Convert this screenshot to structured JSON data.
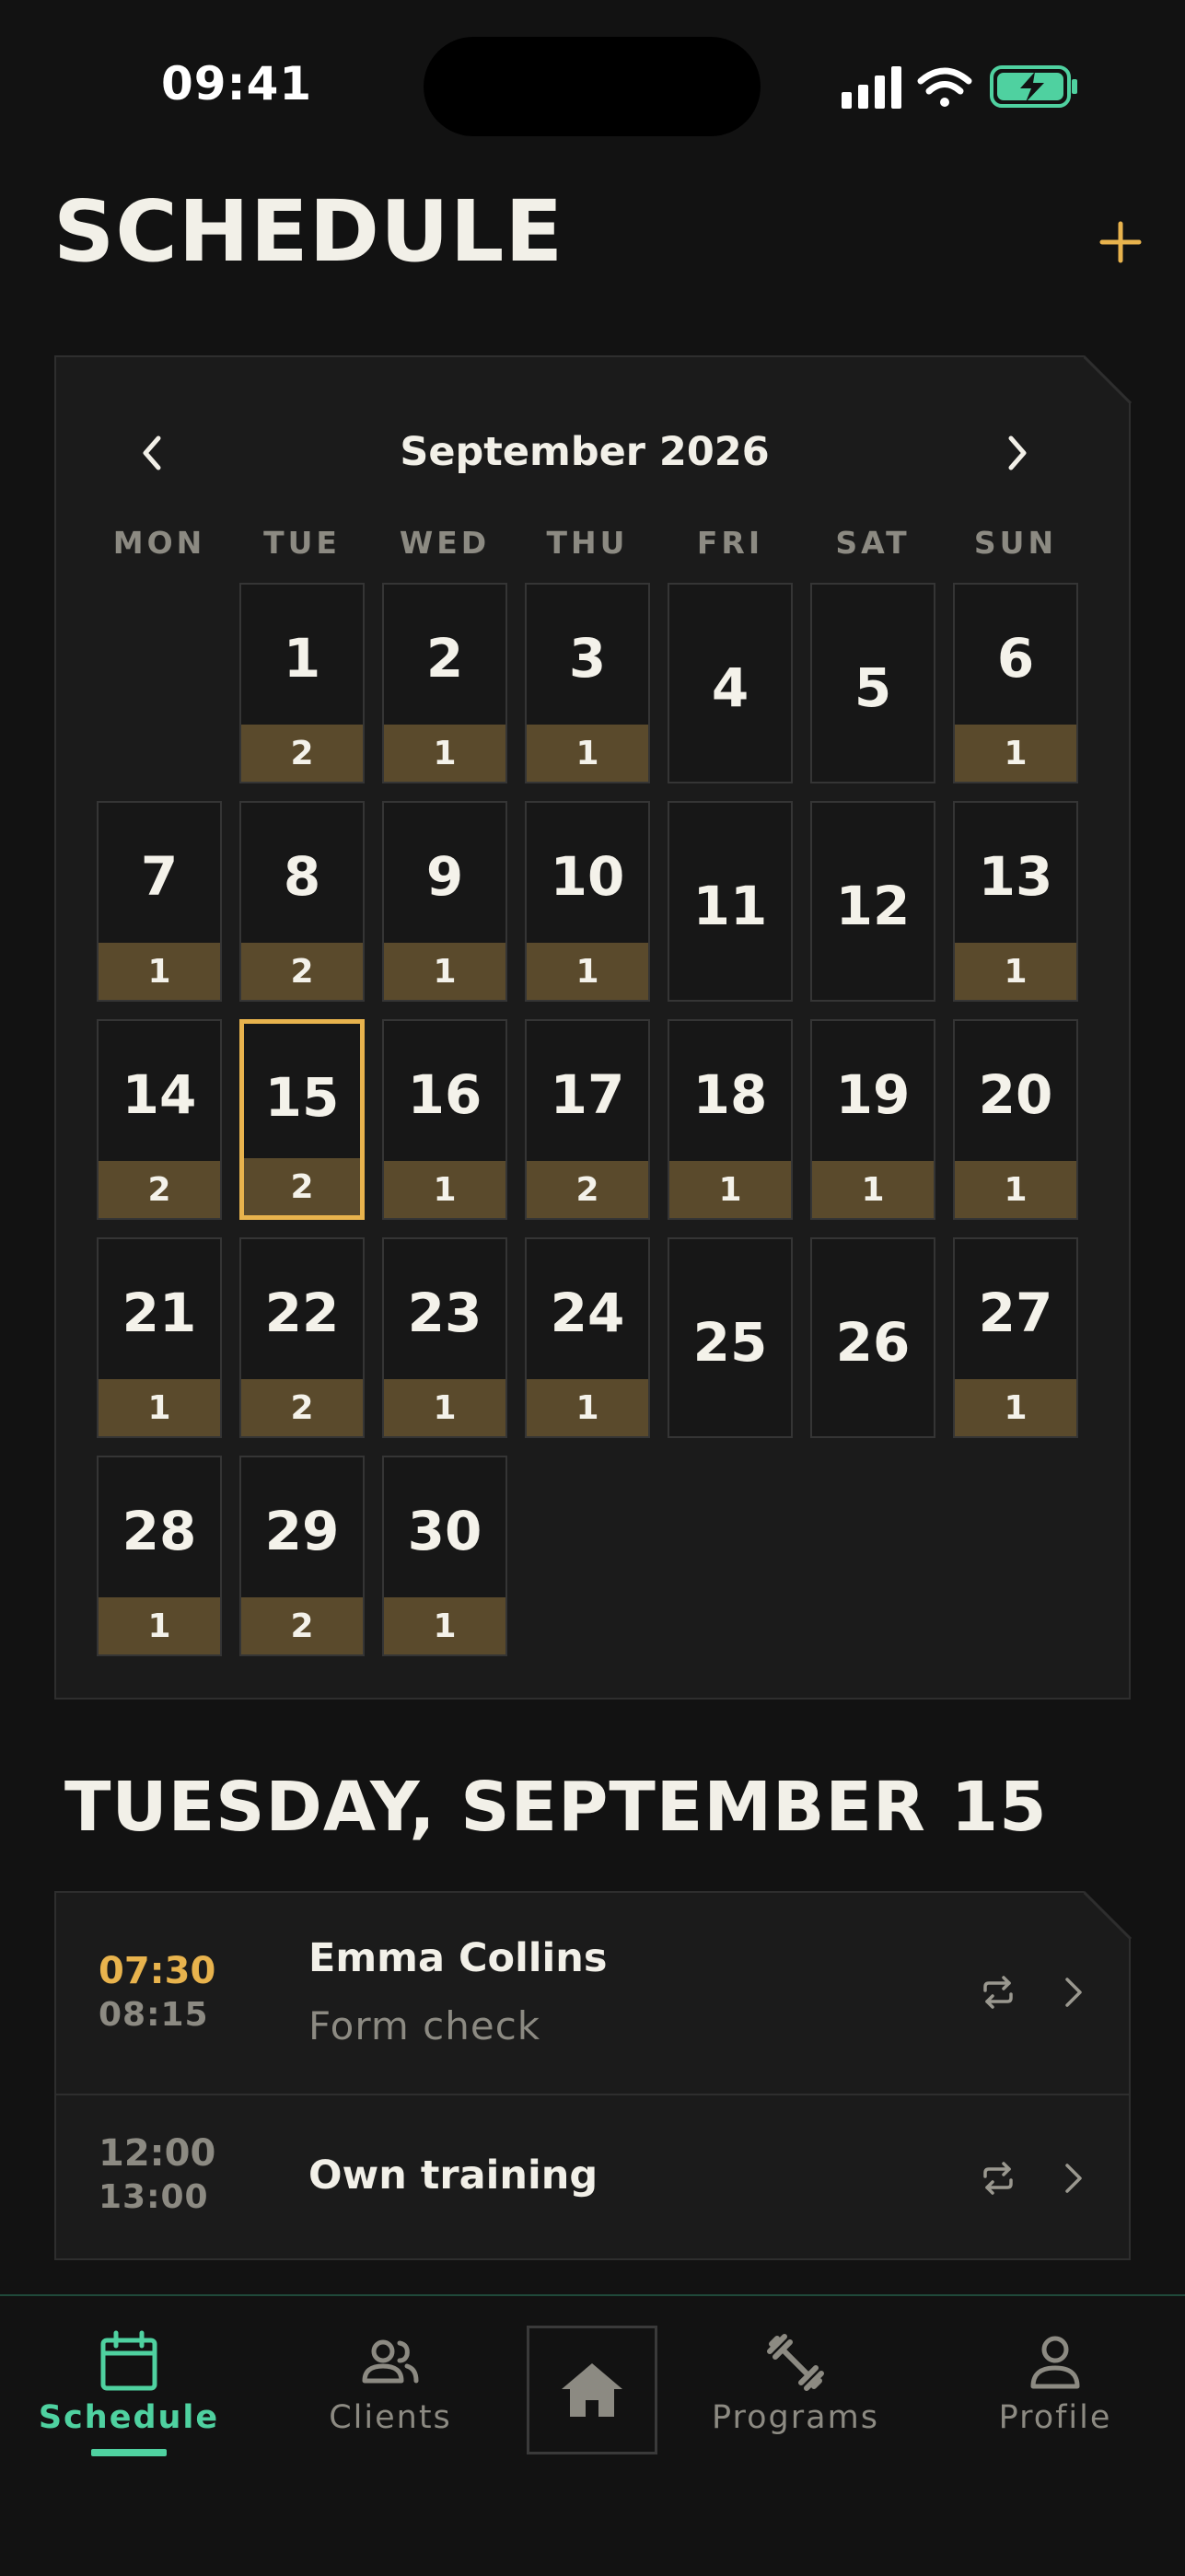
{
  "status_bar": {
    "time": "09:41"
  },
  "header": {
    "title": "SCHEDULE",
    "add_icon": "plus-icon"
  },
  "calendar": {
    "month_label": "September 2026",
    "weekdays": [
      "MON",
      "TUE",
      "WED",
      "THU",
      "FRI",
      "SAT",
      "SUN"
    ],
    "selected_day": "15",
    "days": [
      {
        "day": "1",
        "count": "2"
      },
      {
        "day": "2",
        "count": "1"
      },
      {
        "day": "3",
        "count": "1"
      },
      {
        "day": "4",
        "count": ""
      },
      {
        "day": "5",
        "count": ""
      },
      {
        "day": "6",
        "count": "1"
      },
      {
        "day": "7",
        "count": "1"
      },
      {
        "day": "8",
        "count": "2"
      },
      {
        "day": "9",
        "count": "1"
      },
      {
        "day": "10",
        "count": "1"
      },
      {
        "day": "11",
        "count": ""
      },
      {
        "day": "12",
        "count": ""
      },
      {
        "day": "13",
        "count": "1"
      },
      {
        "day": "14",
        "count": "2"
      },
      {
        "day": "15",
        "count": "2"
      },
      {
        "day": "16",
        "count": "1"
      },
      {
        "day": "17",
        "count": "2"
      },
      {
        "day": "18",
        "count": "1"
      },
      {
        "day": "19",
        "count": "1"
      },
      {
        "day": "20",
        "count": "1"
      },
      {
        "day": "21",
        "count": "1"
      },
      {
        "day": "22",
        "count": "2"
      },
      {
        "day": "23",
        "count": "1"
      },
      {
        "day": "24",
        "count": "1"
      },
      {
        "day": "25",
        "count": ""
      },
      {
        "day": "26",
        "count": ""
      },
      {
        "day": "27",
        "count": "1"
      },
      {
        "day": "28",
        "count": "1"
      },
      {
        "day": "29",
        "count": "2"
      },
      {
        "day": "30",
        "count": "1"
      }
    ]
  },
  "selected_date_heading": "TUESDAY, SEPTEMBER 15",
  "appointments": [
    {
      "start": "07:30",
      "end": "08:15",
      "name": "Emma Collins",
      "subtitle": "Form check",
      "highlight": true
    },
    {
      "start": "12:00",
      "end": "13:00",
      "name": "Own training",
      "subtitle": "",
      "highlight": false
    }
  ],
  "tab_bar": {
    "tabs": [
      {
        "label": "Schedule",
        "icon": "calendar-icon",
        "active": true
      },
      {
        "label": "Clients",
        "icon": "users-icon",
        "active": false
      },
      {
        "label": "",
        "icon": "home-icon",
        "active": false
      },
      {
        "label": "Programs",
        "icon": "dumbbell-icon",
        "active": false
      },
      {
        "label": "Profile",
        "icon": "user-icon",
        "active": false
      }
    ]
  },
  "colors": {
    "accent": "#e8b34d",
    "active_tab": "#4fd1a0",
    "count_bg": "#5a4a2c",
    "background": "#121212",
    "battery": "#4fd1a0"
  }
}
